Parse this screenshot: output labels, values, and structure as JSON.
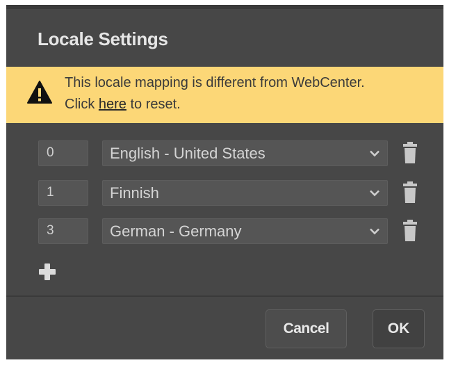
{
  "dialog": {
    "title": "Locale Settings"
  },
  "warning": {
    "line1": "This locale mapping is different from WebCenter.",
    "line2_prefix": "Click ",
    "link_text": "here",
    "line2_suffix": " to reset."
  },
  "mappings": [
    {
      "index": "0",
      "language": "English - United States"
    },
    {
      "index": "1",
      "language": "Finnish"
    },
    {
      "index": "3",
      "language": "German - Germany"
    }
  ],
  "icons": {
    "warning": "warning-triangle-icon",
    "dropdown": "chevron-down-icon",
    "delete": "trash-icon",
    "add": "plus-icon"
  },
  "colors": {
    "dialog_bg": "#474747",
    "warning_bg": "#fcd777",
    "input_bg": "#555555"
  },
  "buttons": {
    "cancel": "Cancel",
    "ok": "OK"
  }
}
